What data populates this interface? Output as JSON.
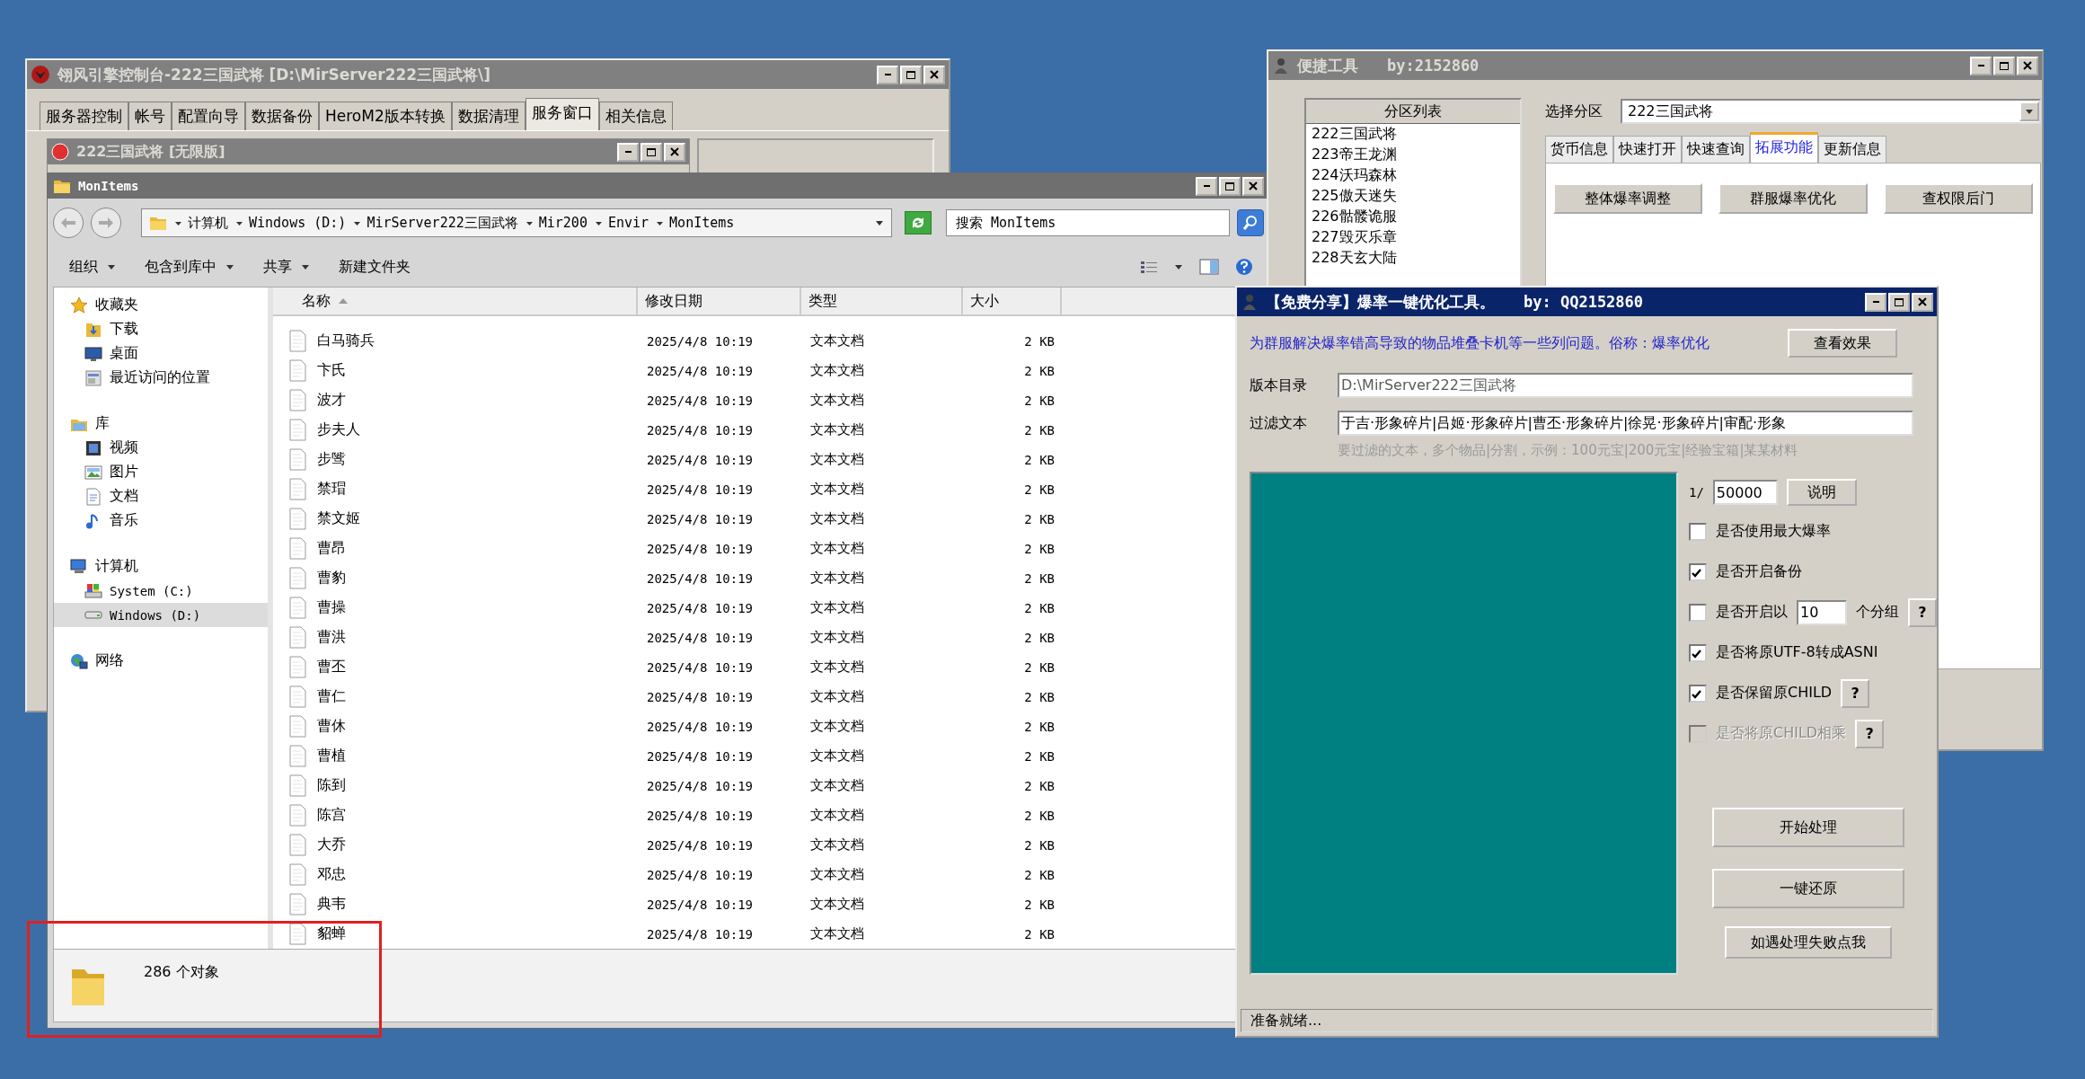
{
  "control_window": {
    "title": "翎风引擎控制台-222三国武将 [D:\\MirServer222三国武将\\]",
    "tabs": [
      {
        "label": "服务器控制",
        "selected": false
      },
      {
        "label": "帐号",
        "selected": false
      },
      {
        "label": "配置向导",
        "selected": false
      },
      {
        "label": "数据备份",
        "selected": false
      },
      {
        "label": "HeroM2版本转换",
        "selected": false
      },
      {
        "label": "数据清理",
        "selected": false
      },
      {
        "label": "服务窗口",
        "selected": true
      },
      {
        "label": "相关信息",
        "selected": false
      }
    ],
    "child_window": {
      "title": "222三国武将 [无限版]"
    }
  },
  "explorer": {
    "title": "MonItems",
    "breadcrumb": [
      "计算机",
      "Windows (D:)",
      "MirServer222三国武将",
      "Mir200",
      "Envir",
      "MonItems"
    ],
    "search": {
      "placeholder": "搜索 MonItems"
    },
    "toolbar": [
      {
        "label": "组织",
        "dropdown": true
      },
      {
        "label": "包含到库中",
        "dropdown": true
      },
      {
        "label": "共享",
        "dropdown": true
      },
      {
        "label": "新建文件夹",
        "dropdown": false
      }
    ],
    "sidebar": [
      {
        "label": "收藏夹",
        "selected": false,
        "children": [
          {
            "label": "下载",
            "selected": false
          },
          {
            "label": "桌面",
            "selected": false
          },
          {
            "label": "最近访问的位置",
            "selected": false
          }
        ]
      },
      {
        "label": "库",
        "selected": false,
        "children": [
          {
            "label": "视频",
            "selected": false
          },
          {
            "label": "图片",
            "selected": false
          },
          {
            "label": "文档",
            "selected": false
          },
          {
            "label": "音乐",
            "selected": false
          }
        ]
      },
      {
        "label": "计算机",
        "selected": false,
        "children": [
          {
            "label": "System (C:)",
            "selected": false
          },
          {
            "label": "Windows (D:)",
            "selected": true
          }
        ]
      },
      {
        "label": "网络",
        "selected": false
      }
    ],
    "table": {
      "columns": [
        {
          "label": "名称",
          "sorted": true
        },
        {
          "label": "修改日期",
          "sorted": false
        },
        {
          "label": "类型",
          "sorted": false
        },
        {
          "label": "大小",
          "sorted": false
        }
      ],
      "rows": [
        {
          "name": "白马骑兵",
          "modified": "2025/4/8 10:19",
          "type": "文本文档",
          "size": "2 KB"
        },
        {
          "name": "卞氏",
          "modified": "2025/4/8 10:19",
          "type": "文本文档",
          "size": "2 KB"
        },
        {
          "name": "波才",
          "modified": "2025/4/8 10:19",
          "type": "文本文档",
          "size": "2 KB"
        },
        {
          "name": "步夫人",
          "modified": "2025/4/8 10:19",
          "type": "文本文档",
          "size": "2 KB"
        },
        {
          "name": "步骘",
          "modified": "2025/4/8 10:19",
          "type": "文本文档",
          "size": "2 KB"
        },
        {
          "name": "禁瑁",
          "modified": "2025/4/8 10:19",
          "type": "文本文档",
          "size": "2 KB"
        },
        {
          "name": "禁文姬",
          "modified": "2025/4/8 10:19",
          "type": "文本文档",
          "size": "2 KB"
        },
        {
          "name": "曹昂",
          "modified": "2025/4/8 10:19",
          "type": "文本文档",
          "size": "2 KB"
        },
        {
          "name": "曹豹",
          "modified": "2025/4/8 10:19",
          "type": "文本文档",
          "size": "2 KB"
        },
        {
          "name": "曹操",
          "modified": "2025/4/8 10:19",
          "type": "文本文档",
          "size": "2 KB"
        },
        {
          "name": "曹洪",
          "modified": "2025/4/8 10:19",
          "type": "文本文档",
          "size": "2 KB"
        },
        {
          "name": "曹丕",
          "modified": "2025/4/8 10:19",
          "type": "文本文档",
          "size": "2 KB"
        },
        {
          "name": "曹仁",
          "modified": "2025/4/8 10:19",
          "type": "文本文档",
          "size": "2 KB"
        },
        {
          "name": "曹休",
          "modified": "2025/4/8 10:19",
          "type": "文本文档",
          "size": "2 KB"
        },
        {
          "name": "曹植",
          "modified": "2025/4/8 10:19",
          "type": "文本文档",
          "size": "2 KB"
        },
        {
          "name": "陈到",
          "modified": "2025/4/8 10:19",
          "type": "文本文档",
          "size": "2 KB"
        },
        {
          "name": "陈宫",
          "modified": "2025/4/8 10:19",
          "type": "文本文档",
          "size": "2 KB"
        },
        {
          "name": "大乔",
          "modified": "2025/4/8 10:19",
          "type": "文本文档",
          "size": "2 KB"
        },
        {
          "name": "邓忠",
          "modified": "2025/4/8 10:19",
          "type": "文本文档",
          "size": "2 KB"
        },
        {
          "name": "典韦",
          "modified": "2025/4/8 10:19",
          "type": "文本文档",
          "size": "2 KB"
        },
        {
          "name": "貂蝉",
          "modified": "2025/4/8 10:19",
          "type": "文本文档",
          "size": "2 KB"
        }
      ]
    },
    "status": "286 个对象"
  },
  "quick_tools": {
    "title": "便捷工具",
    "author": "by:2152860",
    "partition_list": {
      "header": "分区列表",
      "items": [
        "222三国武将",
        "223帝王龙渊",
        "224沃玛森林",
        "225傲天迷失",
        "226骷髅诡服",
        "227毁灭乐章",
        "228天玄大陆"
      ]
    },
    "select": {
      "label": "选择分区",
      "value": "222三国武将"
    },
    "tabs": [
      {
        "label": "货币信息",
        "selected": false
      },
      {
        "label": "快速打开",
        "selected": false
      },
      {
        "label": "快速查询",
        "selected": false
      },
      {
        "label": "拓展功能",
        "selected": true
      },
      {
        "label": "更新信息",
        "selected": false
      }
    ],
    "buttons": [
      "整体爆率调整",
      "群服爆率优化",
      "查权限后门"
    ]
  },
  "rate_tool": {
    "title": "【免费分享】爆率一键优化工具。",
    "author": "by: QQ2152860",
    "description": "为群服解决爆率错高导致的物品堆叠卡机等一些列问题。俗称：爆率优化",
    "view_button": "查看效果",
    "version_dir": {
      "label": "版本目录",
      "value": "D:\\MirServer222三国武将"
    },
    "filter": {
      "label": "过滤文本",
      "value": "于吉·形象碎片|吕姬·形象碎片|曹丕·形象碎片|徐晃·形象碎片|审配·形象",
      "hint": "要过滤的文本，多个物品|分割，示例：100元宝|200元宝|经验宝箱|某某材料"
    },
    "ratio": {
      "prefix": "1/",
      "value": "50000",
      "button": "说明"
    },
    "options": [
      {
        "kind": "plain",
        "label": "是否使用最大爆率",
        "checked": false,
        "disabled": false
      },
      {
        "kind": "plain",
        "label": "是否开启备份",
        "checked": true,
        "disabled": false
      },
      {
        "kind": "count",
        "label": "是否开启以",
        "value": "10",
        "suffix": "个分组",
        "help": "?",
        "checked": false,
        "disabled": false
      },
      {
        "kind": "plain",
        "label": "是否将原UTF-8转成ASNI",
        "checked": true,
        "disabled": false
      },
      {
        "kind": "help",
        "label": "是否保留原CHILD",
        "help": "?",
        "checked": true,
        "disabled": false
      },
      {
        "kind": "help",
        "label": "是否将原CHILD相乘",
        "help": "?",
        "checked": false,
        "disabled": true
      }
    ],
    "actions": [
      "开始处理",
      "一键还原",
      "如遇处理失败点我"
    ],
    "status": "准备就绪..."
  }
}
